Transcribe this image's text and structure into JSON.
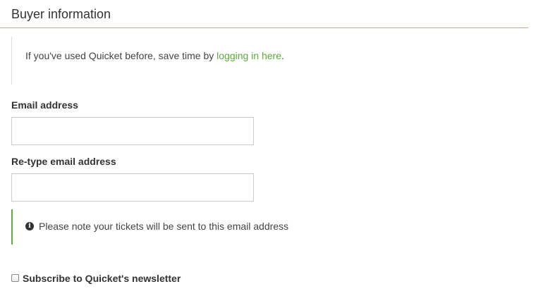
{
  "section": {
    "title": "Buyer information"
  },
  "login_note": {
    "text_before": "If you've used Quicket before, save time by ",
    "link_label": "logging in here",
    "text_after": "."
  },
  "email": {
    "label": "Email address",
    "value": "",
    "placeholder": ""
  },
  "retype_email": {
    "label": "Re-type email address",
    "value": "",
    "placeholder": ""
  },
  "email_note": {
    "icon": "info-circle-icon",
    "text": "Please note your tickets will be sent to this email address"
  },
  "newsletter": {
    "label": "Subscribe to Quicket's newsletter",
    "checked": false
  },
  "colors": {
    "accent_rule": "#e8a15a",
    "link_green": "#5aac3b",
    "note_border_green": "#5aac3b"
  }
}
